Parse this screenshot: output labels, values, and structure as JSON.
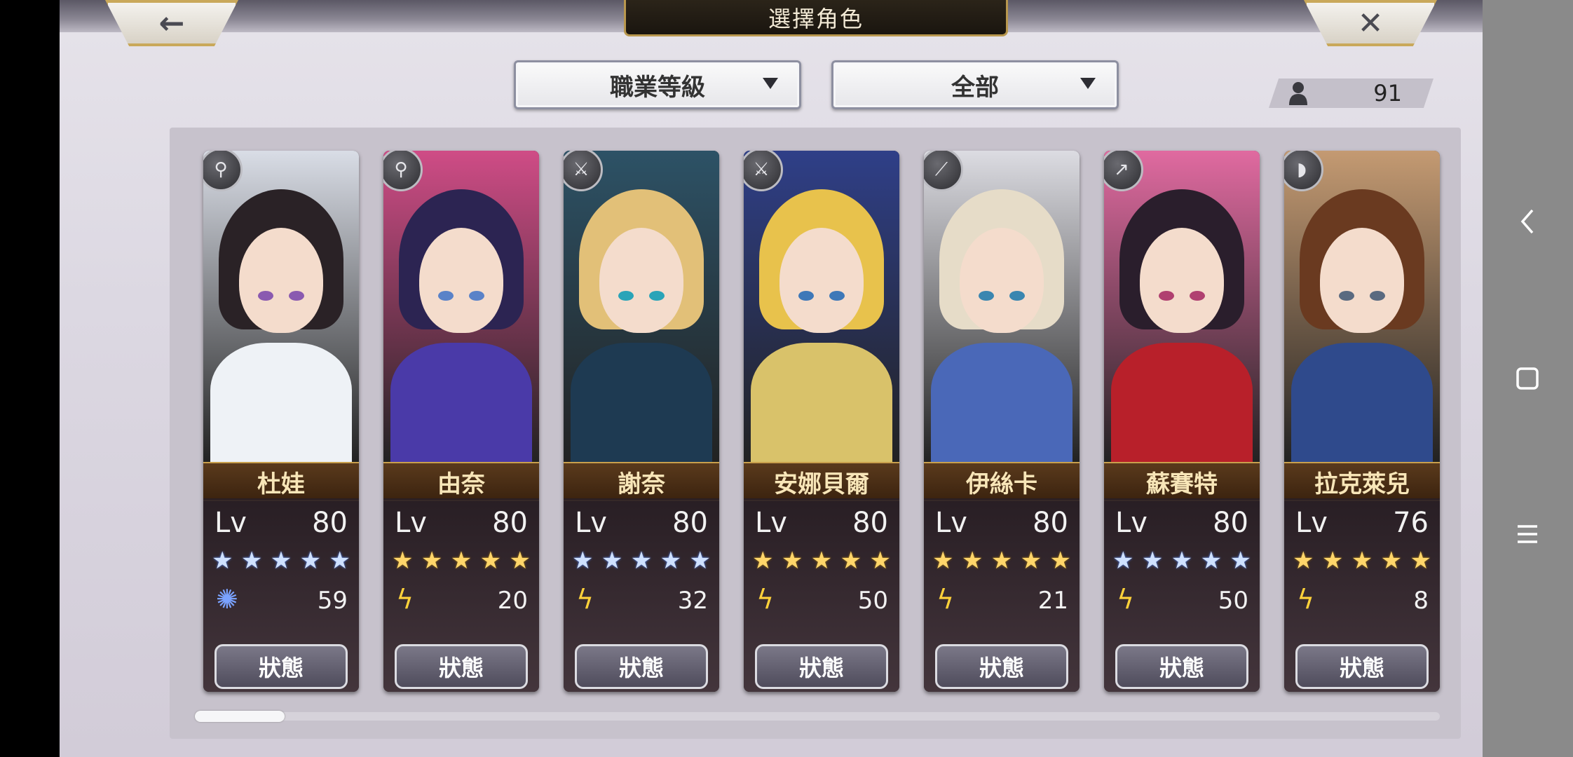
{
  "header": {
    "title": "選擇角色",
    "back_icon": "←",
    "close_icon": "✕"
  },
  "filters": {
    "sort": "職業等級",
    "category": "全部"
  },
  "unit_count": "91",
  "characters": [
    {
      "name": "杜娃",
      "lv_label": "Lv",
      "level": "80",
      "stars": "★★★★★",
      "star_color": "blue",
      "element": "wind",
      "element_value": "59",
      "status_label": "狀態",
      "class": "staff",
      "palette": {
        "bg": "#d9dde6",
        "hair": "#2a2226",
        "body": "#eef2f6",
        "eye": "#8a5ab0"
      }
    },
    {
      "name": "由奈",
      "lv_label": "Lv",
      "level": "80",
      "stars": "★★★★★",
      "star_color": "gold",
      "element": "thunder",
      "element_value": "20",
      "status_label": "狀態",
      "class": "staff",
      "palette": {
        "bg": "#cf4c86",
        "hair": "#2c2452",
        "body": "#4a3aa8",
        "eye": "#5a82c8"
      }
    },
    {
      "name": "謝奈",
      "lv_label": "Lv",
      "level": "80",
      "stars": "★★★★★",
      "star_color": "blue",
      "element": "thunder",
      "element_value": "32",
      "status_label": "狀態",
      "class": "sword",
      "palette": {
        "bg": "#2d5266",
        "hair": "#e2c078",
        "body": "#1e3a52",
        "eye": "#2aa4b8"
      }
    },
    {
      "name": "安娜貝爾",
      "lv_label": "Lv",
      "level": "80",
      "stars": "★★★★★",
      "star_color": "gold",
      "element": "thunder",
      "element_value": "50",
      "status_label": "狀態",
      "class": "sword",
      "palette": {
        "bg": "#2f3f88",
        "hair": "#e8c24c",
        "body": "#d9c26a",
        "eye": "#3e78b8"
      }
    },
    {
      "name": "伊絲卡",
      "lv_label": "Lv",
      "level": "80",
      "stars": "★★★★★",
      "star_color": "gold",
      "element": "thunder",
      "element_value": "21",
      "status_label": "狀態",
      "class": "katana",
      "palette": {
        "bg": "#dcdce2",
        "hair": "#e6dcc8",
        "body": "#4a68b8",
        "eye": "#3a86b0"
      }
    },
    {
      "name": "蘇賽特",
      "lv_label": "Lv",
      "level": "80",
      "stars": "★★★★★",
      "star_color": "blue",
      "element": "thunder",
      "element_value": "50",
      "status_label": "狀態",
      "class": "spear",
      "palette": {
        "bg": "#e06aa0",
        "hair": "#2a1e2c",
        "body": "#b8202a",
        "eye": "#b04070"
      }
    },
    {
      "name": "拉克萊兒",
      "lv_label": "Lv",
      "level": "76",
      "stars": "★★★★★",
      "star_color": "gold",
      "element": "thunder",
      "element_value": "8",
      "status_label": "狀態",
      "class": "bow",
      "palette": {
        "bg": "#c49a72",
        "hair": "#6a3a20",
        "body": "#2f4a8c",
        "eye": "#5a6a80"
      }
    }
  ],
  "icons": {
    "staff": "⚲",
    "sword": "⚔",
    "katana": "⟋",
    "spear": "↗",
    "bow": "◗",
    "wind": "✺",
    "thunder": "ϟ"
  }
}
